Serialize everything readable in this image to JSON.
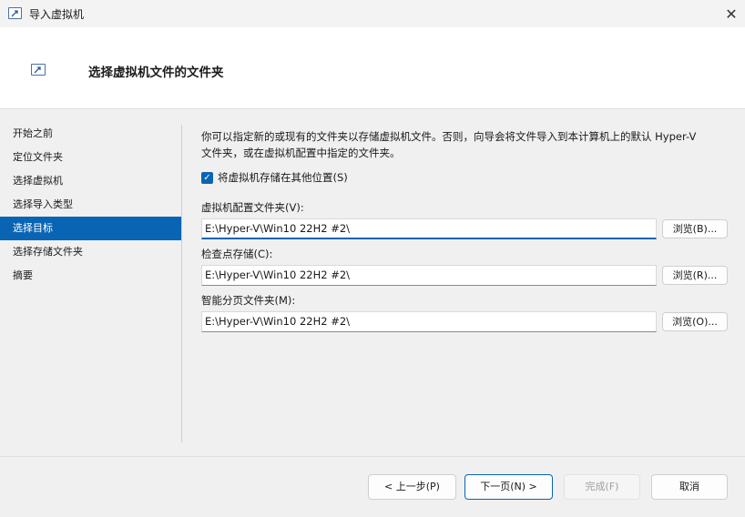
{
  "window": {
    "title": "导入虚拟机",
    "close_glyph": "✕"
  },
  "header": {
    "title": "选择虚拟机文件的文件夹"
  },
  "sidebar": {
    "items": [
      {
        "label": "开始之前"
      },
      {
        "label": "定位文件夹"
      },
      {
        "label": "选择虚拟机"
      },
      {
        "label": "选择导入类型"
      },
      {
        "label": "选择目标",
        "active": true
      },
      {
        "label": "选择存储文件夹"
      },
      {
        "label": "摘要"
      }
    ]
  },
  "main": {
    "description_line1": "你可以指定新的或现有的文件夹以存储虚拟机文件。否则，向导会将文件导入到本计算机上的默认 Hyper-V",
    "description_line2": "文件夹，或在虚拟机配置中指定的文件夹。",
    "checkbox": {
      "label": "将虚拟机存储在其他位置(S)",
      "checked": true
    },
    "fields": [
      {
        "label": "虚拟机配置文件夹(V):",
        "value": "E:\\Hyper-V\\Win10 22H2 #2\\",
        "browse": "浏览(B)..."
      },
      {
        "label": "检查点存储(C):",
        "value": "E:\\Hyper-V\\Win10 22H2 #2\\",
        "browse": "浏览(R)..."
      },
      {
        "label": "智能分页文件夹(M):",
        "value": "E:\\Hyper-V\\Win10 22H2 #2\\",
        "browse": "浏览(O)..."
      }
    ]
  },
  "footer": {
    "prev": "< 上一步(P)",
    "next": "下一页(N) >",
    "finish": "完成(F)",
    "cancel": "取消"
  },
  "colors": {
    "accent": "#0a64b4"
  }
}
